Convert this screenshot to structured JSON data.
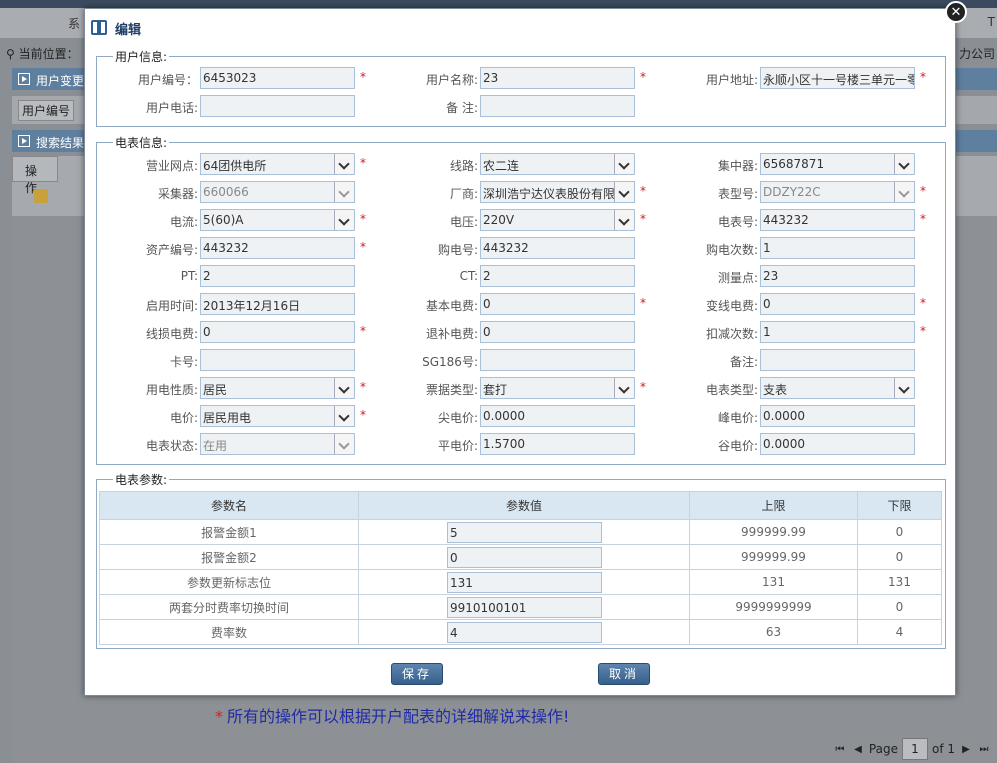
{
  "background": {
    "nav_left": "系",
    "nav_right": "T",
    "location_label": "当前位置：",
    "company": "力公司",
    "panel1_title": "用户变更",
    "field_label": "用户编号",
    "panel2_title": "搜索结果",
    "table_header_op": "操作",
    "note": "所有的操作可以根据开户配表的详细解说来操作!",
    "note_star": "*",
    "pager": {
      "page_label": "Page",
      "page_value": "1",
      "of_label": "of 1"
    }
  },
  "dialog": {
    "title": "编辑",
    "close": "✕",
    "user_info": {
      "legend": "用户信息:",
      "fields": [
        {
          "label": "用户编号：",
          "value": "6453023",
          "required": true
        },
        {
          "label": "用户名称:",
          "value": "23",
          "required": true
        },
        {
          "label": "用户地址:",
          "value": "永顺小区十一号楼三单元一零",
          "required": true
        },
        {
          "label": "用户电话:",
          "value": "",
          "required": false
        },
        {
          "label": "备 注:",
          "value": "",
          "required": false
        }
      ]
    },
    "meter_info": {
      "legend": "电表信息:",
      "fields": [
        {
          "label": "营业网点:",
          "value": "64团供电所",
          "required": true
        },
        {
          "label": "线路:",
          "value": "农二连",
          "required": false
        },
        {
          "label": "集中器:",
          "value": "65687871",
          "required": false
        },
        {
          "label": "采集器:",
          "value": "660066",
          "required": false
        },
        {
          "label": "厂商:",
          "value": "深圳浩宁达仪表股份有限",
          "required": true
        },
        {
          "label": "表型号:",
          "value": "DDZY22C",
          "required": true
        },
        {
          "label": "电流:",
          "value": "5(60)A",
          "required": true
        },
        {
          "label": "电压:",
          "value": "220V",
          "required": true
        },
        {
          "label": "电表号:",
          "value": "443232",
          "required": true
        },
        {
          "label": "资产编号:",
          "value": "443232",
          "required": true
        },
        {
          "label": "购电号:",
          "value": "443232",
          "required": false
        },
        {
          "label": "购电次数:",
          "value": "1",
          "required": false
        },
        {
          "label": "PT:",
          "value": "2",
          "required": false
        },
        {
          "label": "CT:",
          "value": "2",
          "required": false
        },
        {
          "label": "测量点:",
          "value": "23",
          "required": false
        },
        {
          "label": "启用时间:",
          "value": "2013年12月16日",
          "required": false
        },
        {
          "label": "基本电费:",
          "value": "0",
          "required": true
        },
        {
          "label": "变线电费:",
          "value": "0",
          "required": true
        },
        {
          "label": "线损电费:",
          "value": "0",
          "required": true
        },
        {
          "label": "退补电费:",
          "value": "0",
          "required": false
        },
        {
          "label": "扣减次数:",
          "value": "1",
          "required": true
        },
        {
          "label": "卡号:",
          "value": "",
          "required": false
        },
        {
          "label": "SG186号:",
          "value": "",
          "required": false
        },
        {
          "label": "备注:",
          "value": "",
          "required": false
        },
        {
          "label": "用电性质:",
          "value": "居民",
          "required": true
        },
        {
          "label": "票据类型:",
          "value": "套打",
          "required": true
        },
        {
          "label": "电表类型:",
          "value": "支表",
          "required": false
        },
        {
          "label": "电价:",
          "value": "居民用电",
          "required": true
        },
        {
          "label": "尖电价:",
          "value": "0.0000",
          "required": false
        },
        {
          "label": "峰电价:",
          "value": "0.0000",
          "required": false
        },
        {
          "label": "电表状态:",
          "value": "在用",
          "required": false
        },
        {
          "label": "平电价:",
          "value": "1.5700",
          "required": false
        },
        {
          "label": "谷电价:",
          "value": "0.0000",
          "required": false
        }
      ]
    },
    "params": {
      "legend": "电表参数:",
      "headers": [
        "参数名",
        "参数值",
        "上限",
        "下限"
      ],
      "rows": [
        {
          "name": "报警金额1",
          "value": "5",
          "upper": "999999.99",
          "lower": "0"
        },
        {
          "name": "报警金额2",
          "value": "0",
          "upper": "999999.99",
          "lower": "0"
        },
        {
          "name": "参数更新标志位",
          "value": "131",
          "upper": "131",
          "lower": "131"
        },
        {
          "name": "两套分时费率切换时间",
          "value": "9910100101",
          "upper": "9999999999",
          "lower": "0"
        },
        {
          "name": "费率数",
          "value": "4",
          "upper": "63",
          "lower": "4"
        }
      ]
    },
    "save_label": "保存",
    "cancel_label": "取消"
  }
}
